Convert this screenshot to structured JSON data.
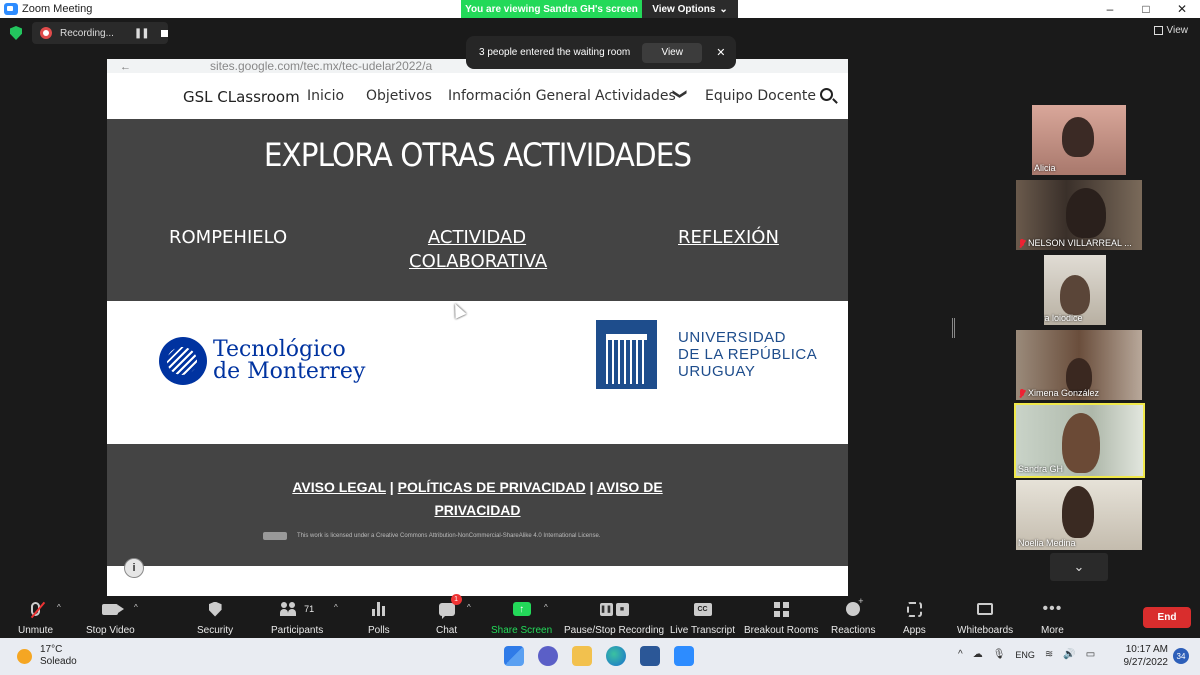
{
  "window": {
    "title": "Zoom Meeting",
    "viewing_banner": "You are viewing Sandra GH's screen",
    "view_options": "View Options",
    "minimize": "–",
    "maximize": "□",
    "close": "✕"
  },
  "recording": {
    "label": "Recording..."
  },
  "view_button": "View",
  "notification": {
    "message": "3 people entered the waiting room",
    "view_label": "View",
    "close": "✕"
  },
  "shared_screen": {
    "url": "sites.google.com/tec.mx/tec-udelar2022/a",
    "site": {
      "brand": "GSL CLassroom",
      "nav": [
        "Inicio",
        "Objetivos",
        "Información General",
        "Actividades",
        "Equipo Docente"
      ],
      "chevron": "❯"
    },
    "explore": {
      "title": "EXPLORA OTRAS ACTIVIDADES",
      "activities": [
        {
          "line1": "ROMPEHIELO",
          "line2": ""
        },
        {
          "line1": "ACTIVIDAD ",
          "line2": "COLABORATIVA"
        },
        {
          "line1": "REFLEXIÓN",
          "line2": ""
        }
      ]
    },
    "logos": {
      "tec_line1": "Tecnológico",
      "tec_line2": "de Monterrey",
      "udelar_line1": "UNIVERSIDAD",
      "udelar_line2": "DE LA REPÚBLICA",
      "udelar_line3": "URUGUAY"
    },
    "footer": {
      "aviso_legal": "AVISO LEGAL",
      "sep": " | ",
      "politicas": "POLÍTICAS DE PRIVACIDAD",
      "aviso_de": "AVISO DE ",
      "privacidad": "PRIVACIDAD",
      "license": "This work is licensed under a Creative Commons Attribution-NonCommercial-ShareAlike 4.0 International License."
    },
    "info_icon": "i"
  },
  "participants": [
    {
      "name": "Alicia",
      "muted": false,
      "bg": "#b98a7a"
    },
    {
      "name": "NELSON VILLARREAL ...",
      "muted": true,
      "bg": "#5a4a40"
    },
    {
      "name": "clara loiodice",
      "muted": true,
      "bg": "#c9c2b6"
    },
    {
      "name": "Ximena González",
      "muted": true,
      "bg": "#7a5e4a"
    },
    {
      "name": "Sandra GH",
      "muted": false,
      "bg": "#c8cfc6"
    },
    {
      "name": "Noelia Medina",
      "muted": false,
      "bg": "#d6d0c4"
    }
  ],
  "scroll_chevron": "⌄",
  "toolbar": {
    "unmute": "Unmute",
    "stop_video": "Stop Video",
    "security": "Security",
    "participants": "Participants",
    "participants_count": "71",
    "polls": "Polls",
    "chat": "Chat",
    "chat_badge": "1",
    "share_screen": "Share Screen",
    "pause_stop": "Pause/Stop Recording",
    "live_transcript": "Live Transcript",
    "cc": "CC",
    "breakout": "Breakout Rooms",
    "reactions": "Reactions",
    "apps": "Apps",
    "whiteboards": "Whiteboards",
    "more": "More",
    "end": "End",
    "caret": "^"
  },
  "taskbar": {
    "temp": "17°C",
    "weather": "Soleado",
    "lang": "ENG",
    "time": "10:17 AM",
    "date": "9/27/2022",
    "notif_count": "34",
    "tray_up": "^",
    "tray_cloud": "☁",
    "tray_mic": "🎙",
    "tray_wifi": "≋",
    "tray_vol": "🔊",
    "tray_battery": "▭"
  }
}
